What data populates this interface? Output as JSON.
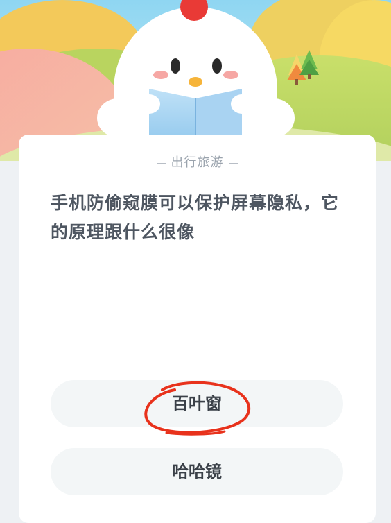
{
  "category": "出行旅游",
  "question": "手机防偷窥膜可以保护屏幕隐私，它的原理跟什么很像",
  "options": [
    {
      "label": "百叶窗",
      "marked": true
    },
    {
      "label": "哈哈镜",
      "marked": false
    }
  ],
  "colors": {
    "accent_mark": "#e8321c",
    "card": "#ffffff",
    "option_bg": "#f3f6f7",
    "question_text": "#4e5661",
    "category_text": "#9aa3ad"
  },
  "icons": [
    "chick-mascot-illustration",
    "tree-icon",
    "handwritten-circle-mark"
  ]
}
